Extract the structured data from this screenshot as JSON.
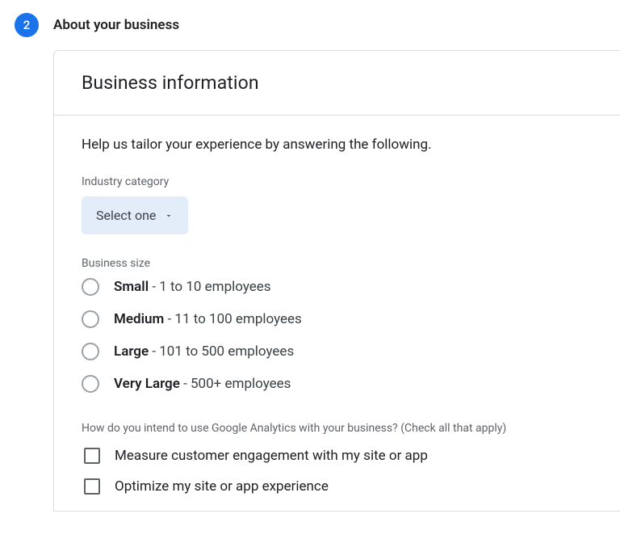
{
  "step": {
    "number": "2",
    "title": "About your business"
  },
  "card": {
    "header": "Business information",
    "intro": "Help us tailor your experience by answering the following."
  },
  "industry": {
    "label": "Industry category",
    "selected": "Select one"
  },
  "business_size": {
    "label": "Business size",
    "options": [
      {
        "name": "Small",
        "detail": " - 1 to 10 employees"
      },
      {
        "name": "Medium",
        "detail": " - 11 to 100 employees"
      },
      {
        "name": "Large",
        "detail": " - 101 to 500 employees"
      },
      {
        "name": "Very Large",
        "detail": " - 500+ employees"
      }
    ]
  },
  "usage": {
    "label": "How do you intend to use Google Analytics with your business? (Check all that apply)",
    "options": [
      "Measure customer engagement with my site or app",
      "Optimize my site or app experience"
    ]
  }
}
